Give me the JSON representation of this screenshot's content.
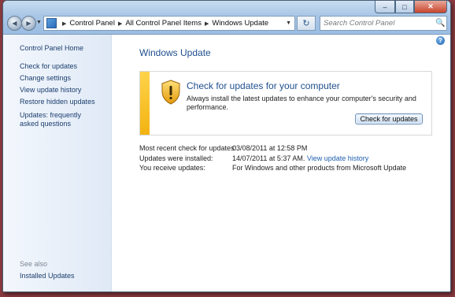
{
  "window": {
    "caption": {
      "minimize": "–",
      "maximize": "□",
      "close": "✕"
    }
  },
  "nav": {
    "back_glyph": "◀",
    "forward_glyph": "▶"
  },
  "address": {
    "crumbs": [
      "Control Panel",
      "All Control Panel Items",
      "Windows Update"
    ]
  },
  "search": {
    "placeholder": "Search Control Panel"
  },
  "sidebar": {
    "home": "Control Panel Home",
    "links": [
      "Check for updates",
      "Change settings",
      "View update history",
      "Restore hidden updates",
      "Updates: frequently asked questions"
    ],
    "see_also_label": "See also",
    "see_also_links": [
      "Installed Updates"
    ]
  },
  "main": {
    "title": "Windows Update",
    "alert": {
      "heading": "Check for updates for your computer",
      "text": "Always install the latest updates to enhance your computer's security and performance.",
      "button": "Check for updates",
      "accent_color": "#f2b311"
    },
    "info": {
      "last_check_label": "Most recent check for updates:",
      "last_check_value": "03/08/2011 at 12:58 PM",
      "installed_label": "Updates were installed:",
      "installed_value": "14/07/2011 at 5:37 AM.",
      "history_link": "View update history",
      "receive_label": "You receive updates:",
      "receive_value": "For Windows and other products from Microsoft Update"
    }
  },
  "icons": {
    "help": "help-icon",
    "shield": "warning-shield-icon",
    "search": "search-icon",
    "refresh": "refresh-icon"
  }
}
